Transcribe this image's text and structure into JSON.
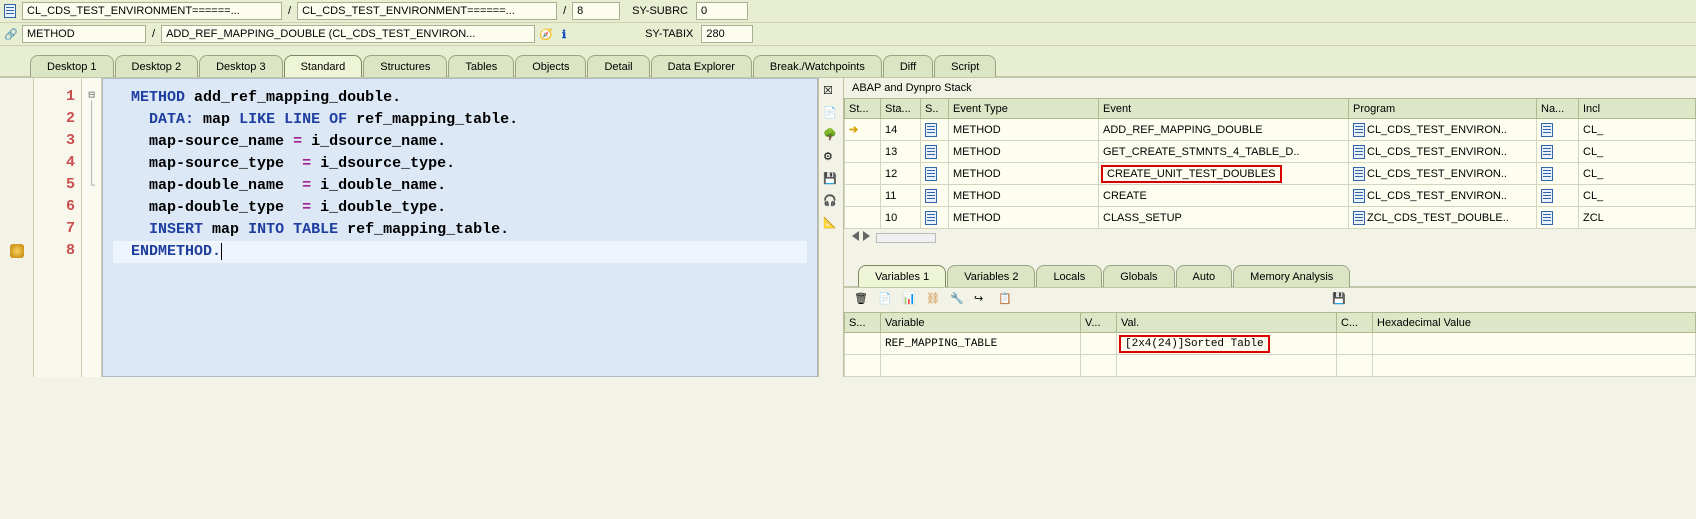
{
  "breadcrumb": {
    "seg1": "CL_CDS_TEST_ENVIRONMENT======...",
    "seg2": "CL_CDS_TEST_ENVIRONMENT======...",
    "seg3": "8",
    "subrc_label": "SY-SUBRC",
    "subrc_val": "0",
    "method_label": "METHOD",
    "method_val": "ADD_REF_MAPPING_DOUBLE (CL_CDS_TEST_ENVIRON...",
    "tabix_label": "SY-TABIX",
    "tabix_val": "280",
    "slash": "/"
  },
  "tabs": [
    "Desktop 1",
    "Desktop 2",
    "Desktop 3",
    "Standard",
    "Structures",
    "Tables",
    "Objects",
    "Detail",
    "Data Explorer",
    "Break./Watchpoints",
    "Diff",
    "Script"
  ],
  "tabs_selected": "Standard",
  "code": {
    "lines": [
      "1",
      "2",
      "3",
      "4",
      "5",
      "6",
      "7",
      "8"
    ],
    "l1_kw": "METHOD",
    "l1_id": "add_ref_mapping_double",
    "l2_kw1": "DATA:",
    "l2_id1": "map",
    "l2_kw2": "LIKE LINE OF",
    "l2_id2": "ref_mapping_table",
    "l3_lhs": "map-source_name",
    "l3_eq": "=",
    "l3_rhs": "i_dsource_name",
    "l4_lhs": "map-source_type",
    "l4_eq": "=",
    "l4_rhs": "i_dsource_type",
    "l5_lhs": "map-double_name",
    "l5_eq": "=",
    "l5_rhs": "i_double_name",
    "l6_lhs": "map-double_type",
    "l6_eq": "=",
    "l6_rhs": "i_double_type",
    "l7_kw1": "INSERT",
    "l7_id1": "map",
    "l7_kw2": "INTO TABLE",
    "l7_id2": "ref_mapping_table",
    "l8_kw": "ENDMETHOD.",
    "dot": "."
  },
  "stack": {
    "title": "ABAP and Dynpro Stack",
    "cols": [
      "St...",
      "Sta...",
      "S..",
      "Event Type",
      "Event",
      "Program",
      "Na...",
      "Incl"
    ],
    "rows": [
      {
        "cur": true,
        "stack": "14",
        "etype": "METHOD",
        "event": "ADD_REF_MAPPING_DOUBLE",
        "prog": "CL_CDS_TEST_ENVIRON..",
        "na": "",
        "incl": "CL_"
      },
      {
        "cur": false,
        "stack": "13",
        "etype": "METHOD",
        "event": "GET_CREATE_STMNTS_4_TABLE_D..",
        "prog": "CL_CDS_TEST_ENVIRON..",
        "na": "",
        "incl": "CL_"
      },
      {
        "cur": false,
        "stack": "12",
        "etype": "METHOD",
        "event": "CREATE_UNIT_TEST_DOUBLES",
        "prog": "CL_CDS_TEST_ENVIRON..",
        "na": "",
        "incl": "CL_",
        "hl": true
      },
      {
        "cur": false,
        "stack": "11",
        "etype": "METHOD",
        "event": "CREATE",
        "prog": "CL_CDS_TEST_ENVIRON..",
        "na": "",
        "incl": "CL_"
      },
      {
        "cur": false,
        "stack": "10",
        "etype": "METHOD",
        "event": "CLASS_SETUP",
        "prog": "ZCL_CDS_TEST_DOUBLE..",
        "na": "",
        "incl": "ZCL"
      }
    ]
  },
  "vartabs": [
    "Variables 1",
    "Variables 2",
    "Locals",
    "Globals",
    "Auto",
    "Memory Analysis"
  ],
  "vartabs_selected": "Variables 1",
  "vars": {
    "cols": [
      "S...",
      "Variable",
      "V...",
      "Val.",
      "C...",
      "Hexadecimal Value"
    ],
    "rows": [
      {
        "var": "REF_MAPPING_TABLE",
        "val": "[2x4(24)]Sorted Table",
        "hl": true
      }
    ]
  },
  "chart_data": null
}
